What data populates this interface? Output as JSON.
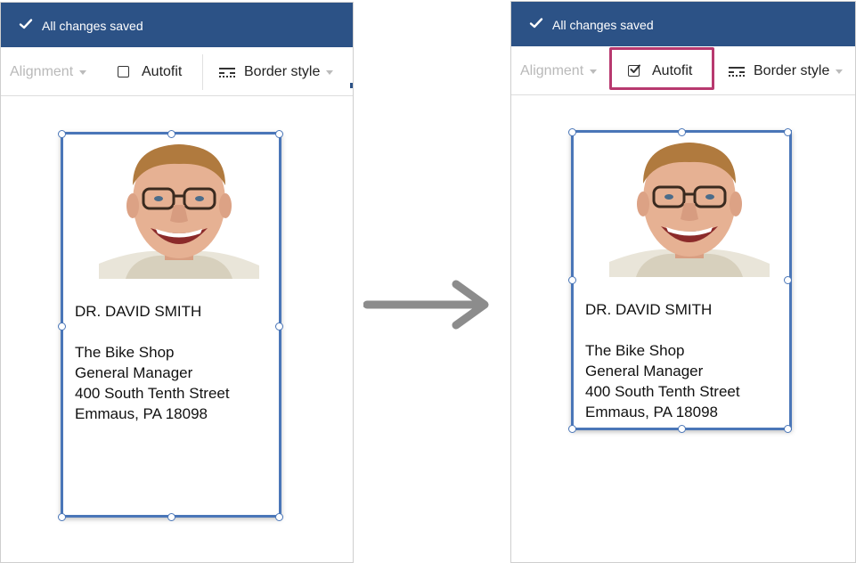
{
  "before": {
    "save_status": "All changes saved",
    "toolbar": {
      "alignment": "Alignment",
      "autofit": "Autofit",
      "autofit_checked": false,
      "border_style": "Border style"
    },
    "card": {
      "name": "DR. DAVID SMITH",
      "address_lines": [
        "The Bike Shop",
        "General Manager",
        "400 South Tenth Street",
        "Emmaus, PA 18098"
      ]
    }
  },
  "after": {
    "save_status": "All changes saved",
    "toolbar": {
      "alignment": "Alignment",
      "autofit": "Autofit",
      "autofit_checked": true,
      "border_style": "Border style"
    },
    "card": {
      "name": "DR. DAVID SMITH",
      "address_lines": [
        "The Bike Shop",
        "General Manager",
        "400 South Tenth Street",
        "Emmaus, PA 18098"
      ]
    }
  },
  "colors": {
    "title_bar": "#2c5286",
    "selection": "#4a76b8",
    "highlight": "#b8396f",
    "arrow": "#8c8c8c"
  },
  "icons": {
    "saved": "check-icon",
    "autofit_unchecked": "checkbox-empty-icon",
    "autofit_checked": "checkbox-checked-icon",
    "border": "border-style-icon",
    "transition": "right-arrow-icon"
  }
}
